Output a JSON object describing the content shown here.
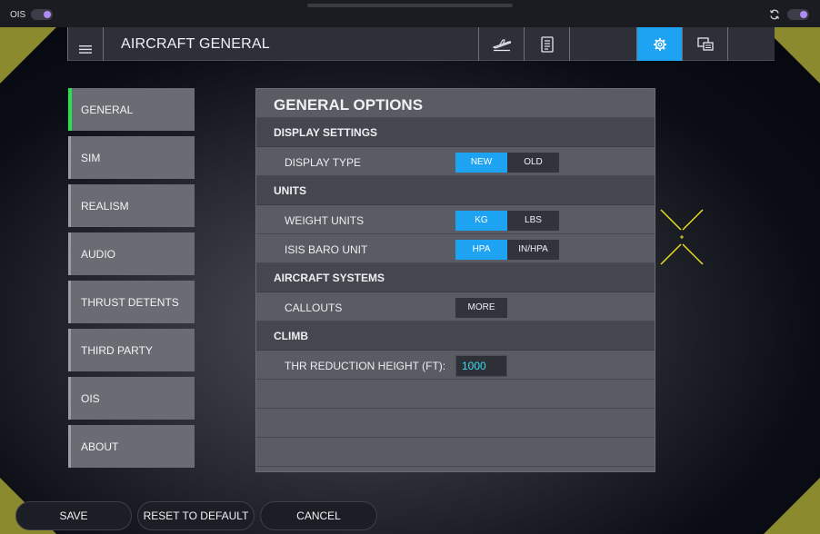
{
  "topbar": {
    "ois_label": "OIS",
    "left_toggle_on": true,
    "right_toggle_on": true,
    "accent_color": "#b18cf0"
  },
  "header": {
    "title": "AIRCRAFT GENERAL",
    "menu_icon": "hamburger-icon",
    "tabs": [
      {
        "icon": "aircraft-takeoff-icon",
        "active": false
      },
      {
        "icon": "checklist-icon",
        "active": false
      },
      {
        "icon": "blank",
        "active": false
      },
      {
        "icon": "gear-icon",
        "active": true
      },
      {
        "icon": "display-settings-icon",
        "active": false
      },
      {
        "icon": "blank",
        "active": false
      }
    ],
    "active_color": "#1ea3f2"
  },
  "nav": {
    "items": [
      {
        "label": "GENERAL",
        "active": true
      },
      {
        "label": "SIM",
        "active": false
      },
      {
        "label": "REALISM",
        "active": false
      },
      {
        "label": "AUDIO",
        "active": false
      },
      {
        "label": "THRUST DETENTS",
        "active": false
      },
      {
        "label": "THIRD PARTY",
        "active": false
      },
      {
        "label": "OIS",
        "active": false
      },
      {
        "label": "ABOUT",
        "active": false
      }
    ],
    "active_color": "#25e34a"
  },
  "panel": {
    "title": "GENERAL OPTIONS",
    "sections": {
      "display": {
        "title": "DISPLAY SETTINGS",
        "display_type": {
          "label": "DISPLAY TYPE",
          "options": [
            "NEW",
            "OLD"
          ],
          "selected": "NEW"
        }
      },
      "units": {
        "title": "UNITS",
        "weight_units": {
          "label": "WEIGHT UNITS",
          "options": [
            "KG",
            "LBS"
          ],
          "selected": "KG"
        },
        "isis_baro": {
          "label": "ISIS BARO UNIT",
          "options": [
            "HPA",
            "IN/HPA"
          ],
          "selected": "HPA"
        }
      },
      "systems": {
        "title": "AIRCRAFT SYSTEMS",
        "callouts": {
          "label": "CALLOUTS",
          "button": "MORE"
        }
      },
      "climb": {
        "title": "CLIMB",
        "thr_reduction": {
          "label": "THR REDUCTION HEIGHT (FT):",
          "value": "1000"
        }
      }
    }
  },
  "footer": {
    "save": "SAVE",
    "reset": "RESET TO DEFAULT",
    "cancel": "CANCEL"
  },
  "colors": {
    "corner_accent": "#8c8a2e",
    "crosshair": "#e8e020",
    "input_text": "#33e0f0"
  }
}
